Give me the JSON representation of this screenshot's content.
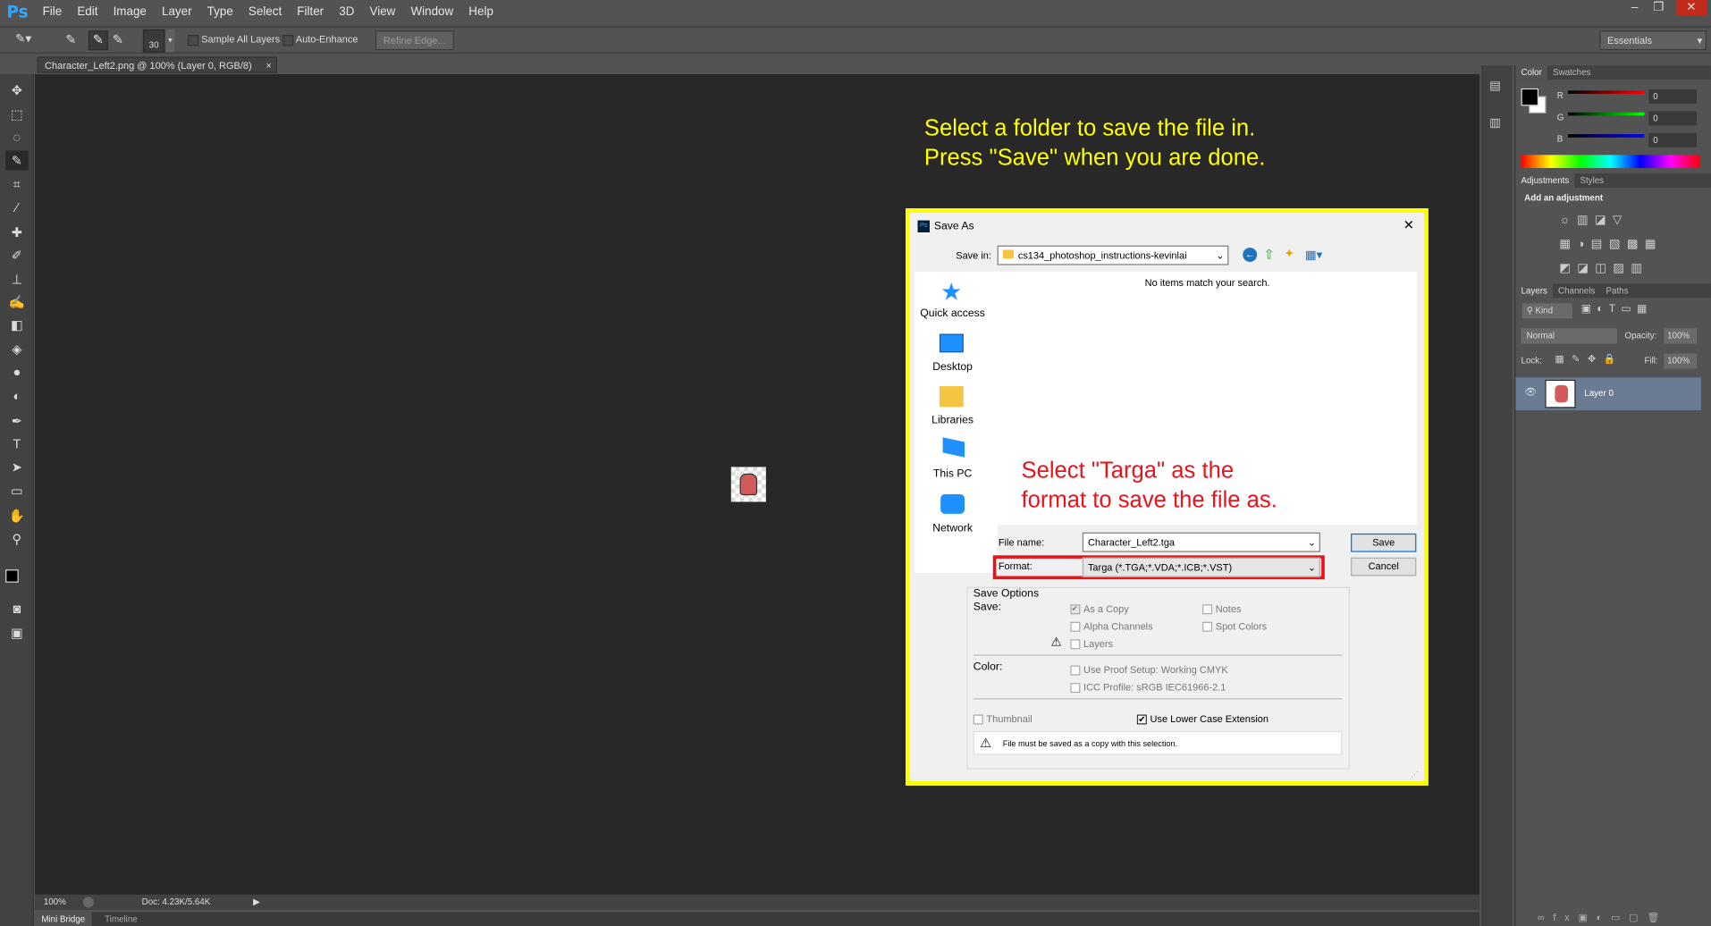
{
  "app": {
    "logo": "Ps"
  },
  "menu": [
    "File",
    "Edit",
    "Image",
    "Layer",
    "Type",
    "Select",
    "Filter",
    "3D",
    "View",
    "Window",
    "Help"
  ],
  "options": {
    "brush_size": "30",
    "sample_all_layers": "Sample All Layers",
    "auto_enhance": "Auto-Enhance",
    "refine_edge": "Refine Edge...",
    "workspace": "Essentials"
  },
  "document_tab": {
    "title": "Character_Left2.png @ 100% (Layer 0, RGB/8)",
    "close": "×"
  },
  "status": {
    "zoom": "100%",
    "doc": "Doc: 4.23K/5.64K"
  },
  "bottom_tabs": [
    "Mini Bridge",
    "Timeline"
  ],
  "annotations": {
    "top": "Select a folder to save the file in.\nPress \"Save\" when you are done.",
    "format": "Select \"Targa\" as the\nformat to save the file as."
  },
  "colors": {
    "highlight": "#ffff00",
    "red_note": "#e8141c",
    "selection": "#cce8ff"
  },
  "color_panel": {
    "tabs": [
      "Color",
      "Swatches"
    ],
    "r_label": "R",
    "g_label": "G",
    "b_label": "B",
    "r": "0",
    "g": "0",
    "b": "0"
  },
  "adjustments_panel": {
    "tabs": [
      "Adjustments",
      "Styles"
    ],
    "heading": "Add an adjustment"
  },
  "layers_panel": {
    "tabs": [
      "Layers",
      "Channels",
      "Paths"
    ],
    "kind": "Kind",
    "blend": "Normal",
    "opacity_label": "Opacity:",
    "opacity": "100%",
    "lock_label": "Lock:",
    "fill_label": "Fill:",
    "fill": "100%",
    "layer_name": "Layer 0"
  },
  "dialog": {
    "title": "Save As",
    "save_in_label": "Save in:",
    "folder": "cs134_photoshop_instructions-kevinlai",
    "empty_msg": "No items match your search.",
    "places": [
      "Quick access",
      "Desktop",
      "Libraries",
      "This PC",
      "Network"
    ],
    "file_name_label": "File name:",
    "file_name": "Character_Left2.tga",
    "format_label": "Format:",
    "format": "Targa (*.TGA;*.VDA;*.ICB;*.VST)",
    "save_btn": "Save",
    "cancel_btn": "Cancel",
    "save_options": "Save Options",
    "save_label": "Save:",
    "as_copy": "As a Copy",
    "notes": "Notes",
    "alpha": "Alpha Channels",
    "spot": "Spot Colors",
    "layers": "Layers",
    "color_label": "Color:",
    "proof": "Use Proof Setup:  Working CMYK",
    "icc": "ICC Profile:  sRGB IEC61966-2.1",
    "thumbnail": "Thumbnail",
    "lower_case": "Use Lower Case Extension",
    "warning": "File must be saved as a copy with this selection."
  }
}
